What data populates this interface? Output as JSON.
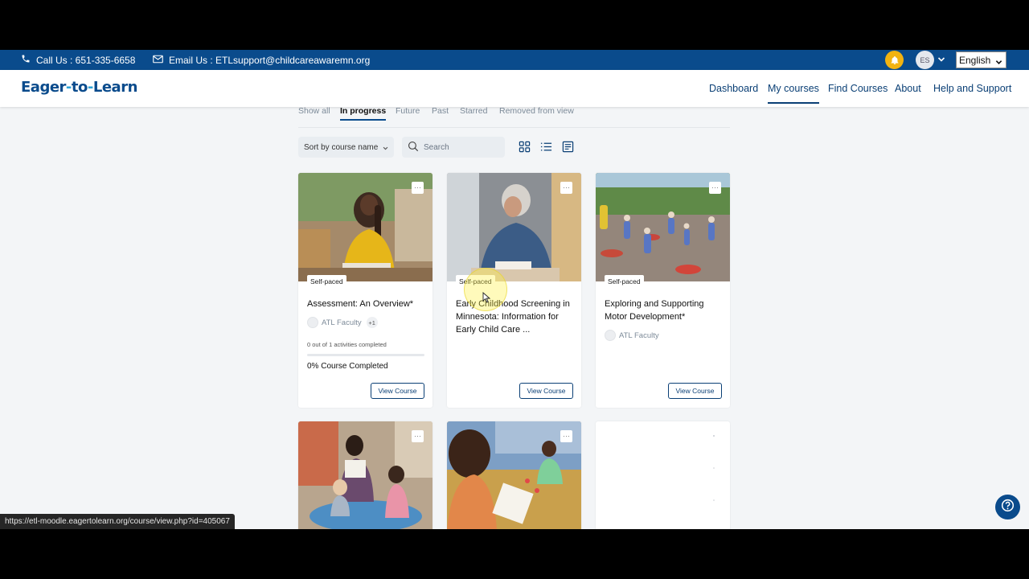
{
  "topbar": {
    "phone_label": "Call Us : 651-335-6658",
    "email_label": "Email Us : ETLsupport@childcareawaremn.org",
    "avatar_initials": "ES",
    "language": "English"
  },
  "brand": {
    "part1": "Eager",
    "dash1": "-",
    "part2": "to",
    "dash2": "-",
    "part3": "Learn",
    "primary_color": "#0a4b8c",
    "accent_color": "#2ea3d6"
  },
  "nav": {
    "items": [
      {
        "label": "Dashboard"
      },
      {
        "label": "My courses",
        "active": true
      },
      {
        "label": "Find Courses"
      },
      {
        "label": "About"
      },
      {
        "label": "Help and Support"
      }
    ]
  },
  "filters": {
    "tabs": [
      {
        "label": "Show all"
      },
      {
        "label": "In progress",
        "active": true
      },
      {
        "label": "Future"
      },
      {
        "label": "Past"
      },
      {
        "label": "Starred"
      },
      {
        "label": "Removed from view"
      }
    ],
    "sort_label": "Sort by course name",
    "search_placeholder": "Search",
    "view_icons": [
      "grid-view-icon",
      "list-view-icon",
      "summary-view-icon"
    ]
  },
  "courses": [
    {
      "badge": "Self-paced",
      "title": "Assessment: An Overview*",
      "teacher": "ATL Faculty",
      "extra_teachers": "+1",
      "activities": "0 out of 1 activities completed",
      "progress_pct": 0,
      "progress_label": "0% Course Completed",
      "button": "View Course"
    },
    {
      "badge": "Self-paced",
      "title": "Early Childhood Screening in Minnesota: Information for Early Child Care ...",
      "button": "View Course"
    },
    {
      "badge": "Self-paced",
      "title": "Exploring and Supporting Motor Development*",
      "teacher": "ATL Faculty",
      "button": "View Course"
    }
  ],
  "status_url": "https://etl-moodle.eagertolearn.org/course/view.php?id=405067"
}
